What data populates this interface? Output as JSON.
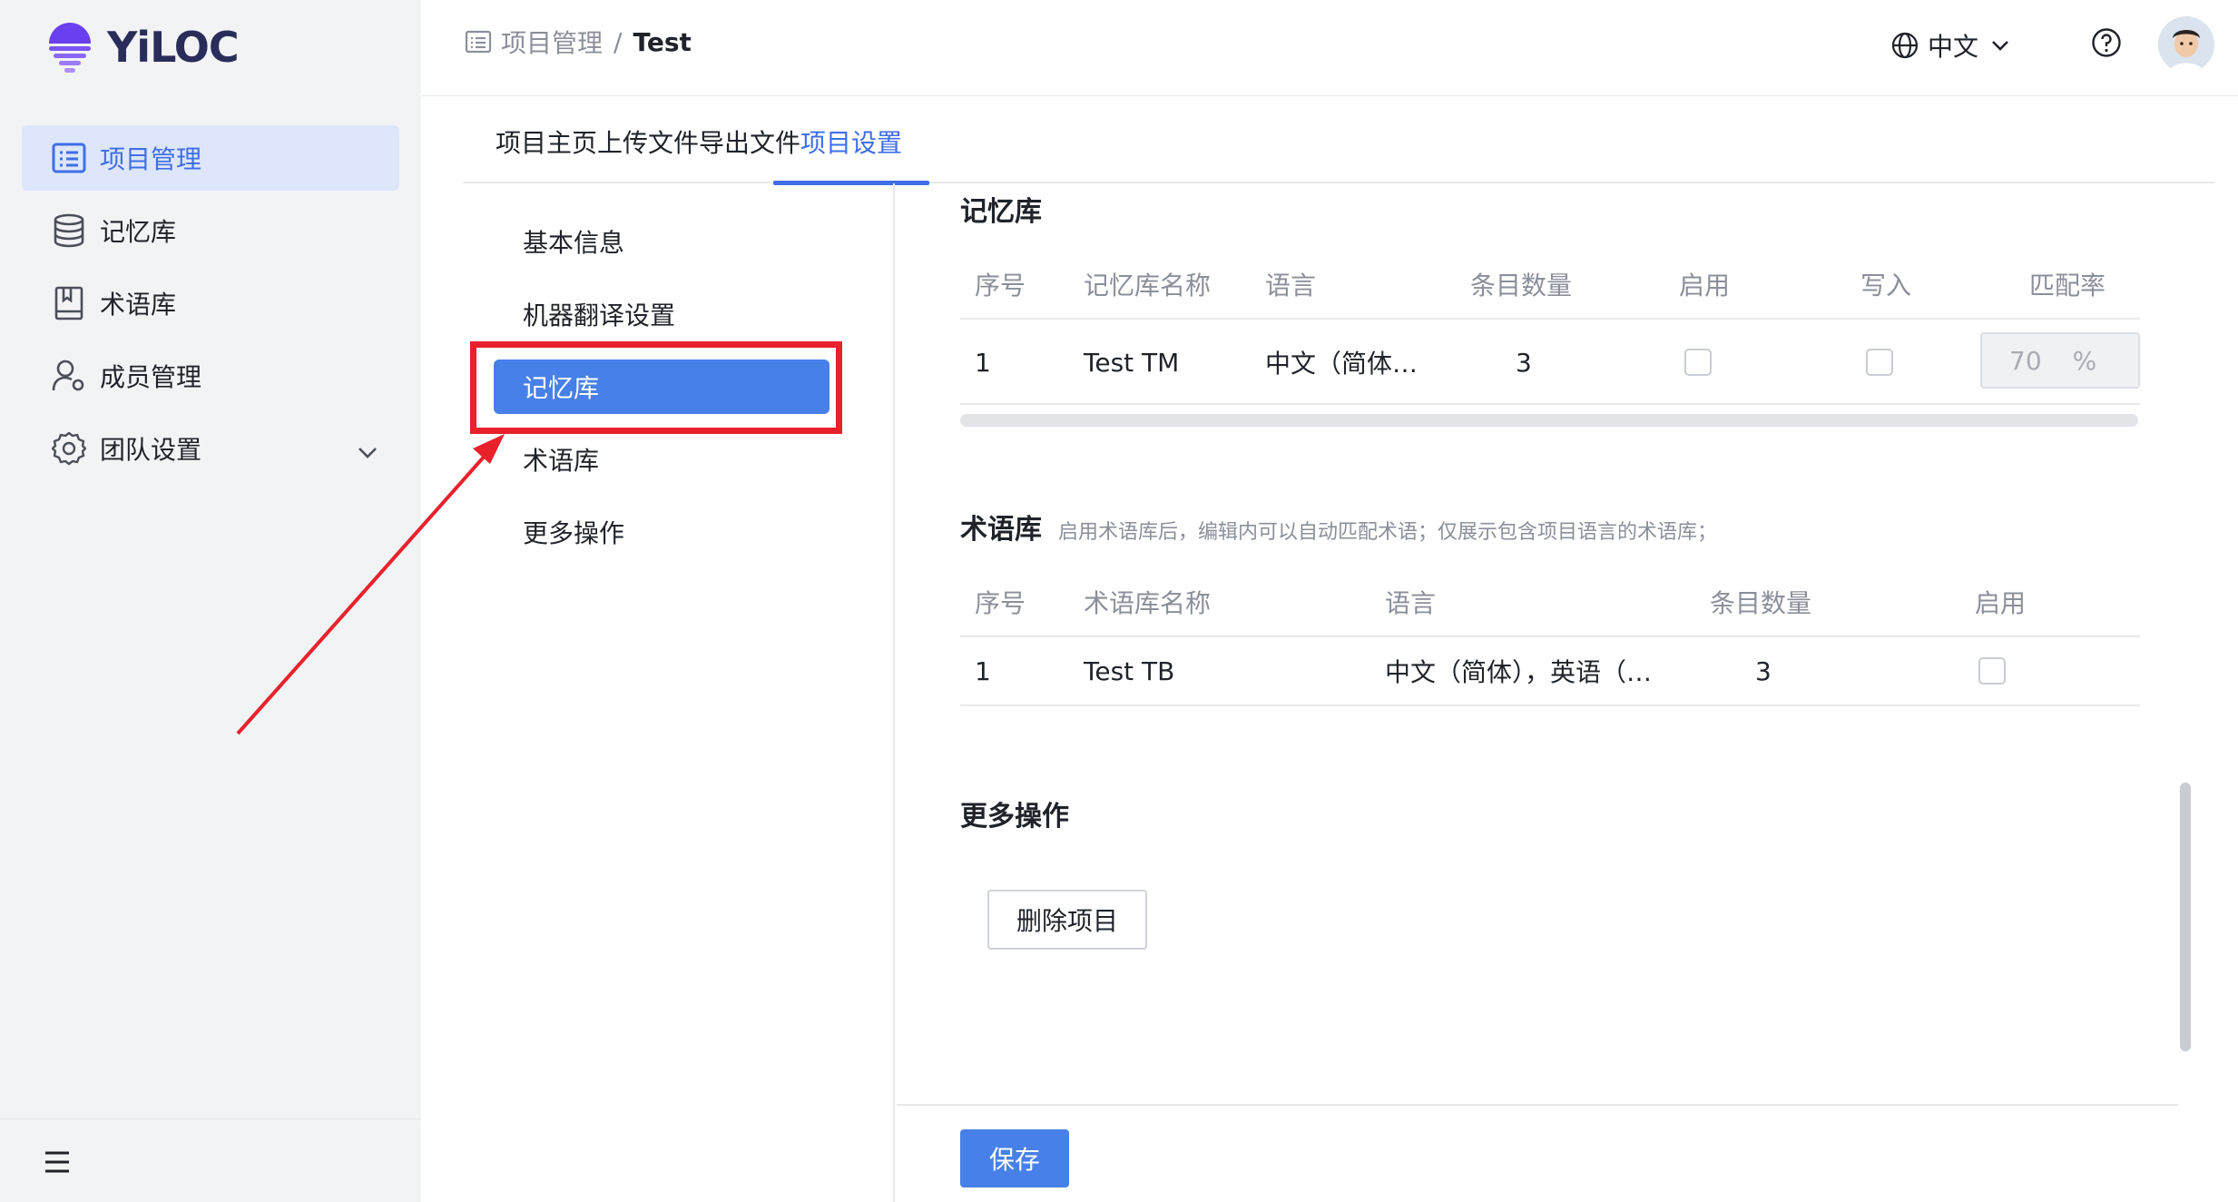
{
  "app": {
    "logo_text": "YiLOC",
    "brand_color": "#6a3ff0",
    "accent_color": "#3f6ee6",
    "highlight_color": "#e8212b"
  },
  "sidebar": {
    "items": [
      {
        "label": "项目管理",
        "icon": "project-list-icon",
        "active": true
      },
      {
        "label": "记忆库",
        "icon": "database-icon",
        "active": false
      },
      {
        "label": "术语库",
        "icon": "book-icon",
        "active": false
      },
      {
        "label": "成员管理",
        "icon": "member-settings-icon",
        "active": false
      },
      {
        "label": "团队设置",
        "icon": "gear-icon",
        "active": false,
        "expandable": true
      }
    ],
    "footer_icon": "hamburger-menu-icon"
  },
  "header": {
    "breadcrumb": {
      "root": "项目管理",
      "separator": "/",
      "current": "Test"
    },
    "language": "中文",
    "help_icon": "help-circle-icon",
    "avatar_icon": "user-avatar"
  },
  "tabs": [
    {
      "label": "项目主页",
      "active": false
    },
    {
      "label": "上传文件",
      "active": false
    },
    {
      "label": "导出文件",
      "active": false
    },
    {
      "label": "项目设置",
      "active": true
    }
  ],
  "settings_menu": [
    {
      "label": "基本信息",
      "active": false
    },
    {
      "label": "机器翻译设置",
      "active": false
    },
    {
      "label": "记忆库",
      "active": true
    },
    {
      "label": "术语库",
      "active": false
    },
    {
      "label": "更多操作",
      "active": false
    }
  ],
  "tm_section": {
    "title": "记忆库",
    "columns": [
      "序号",
      "记忆库名称",
      "语言",
      "条目数量",
      "启用",
      "写入",
      "匹配率"
    ],
    "rows": [
      {
        "index": "1",
        "name": "Test TM",
        "language": "中文（简体…",
        "count": "3",
        "enabled": false,
        "write": false,
        "rate": "70",
        "rate_unit": "%"
      }
    ]
  },
  "tb_section": {
    "title": "术语库",
    "hint": "启用术语库后，编辑内可以自动匹配术语；仅展示包含项目语言的术语库；",
    "columns": [
      "序号",
      "术语库名称",
      "语言",
      "条目数量",
      "启用"
    ],
    "rows": [
      {
        "index": "1",
        "name": "Test TB",
        "language": "中文（简体），英语（…",
        "count": "3",
        "enabled": false
      }
    ]
  },
  "more_section": {
    "title": "更多操作",
    "delete_label": "删除项目"
  },
  "footer": {
    "save_label": "保存"
  }
}
